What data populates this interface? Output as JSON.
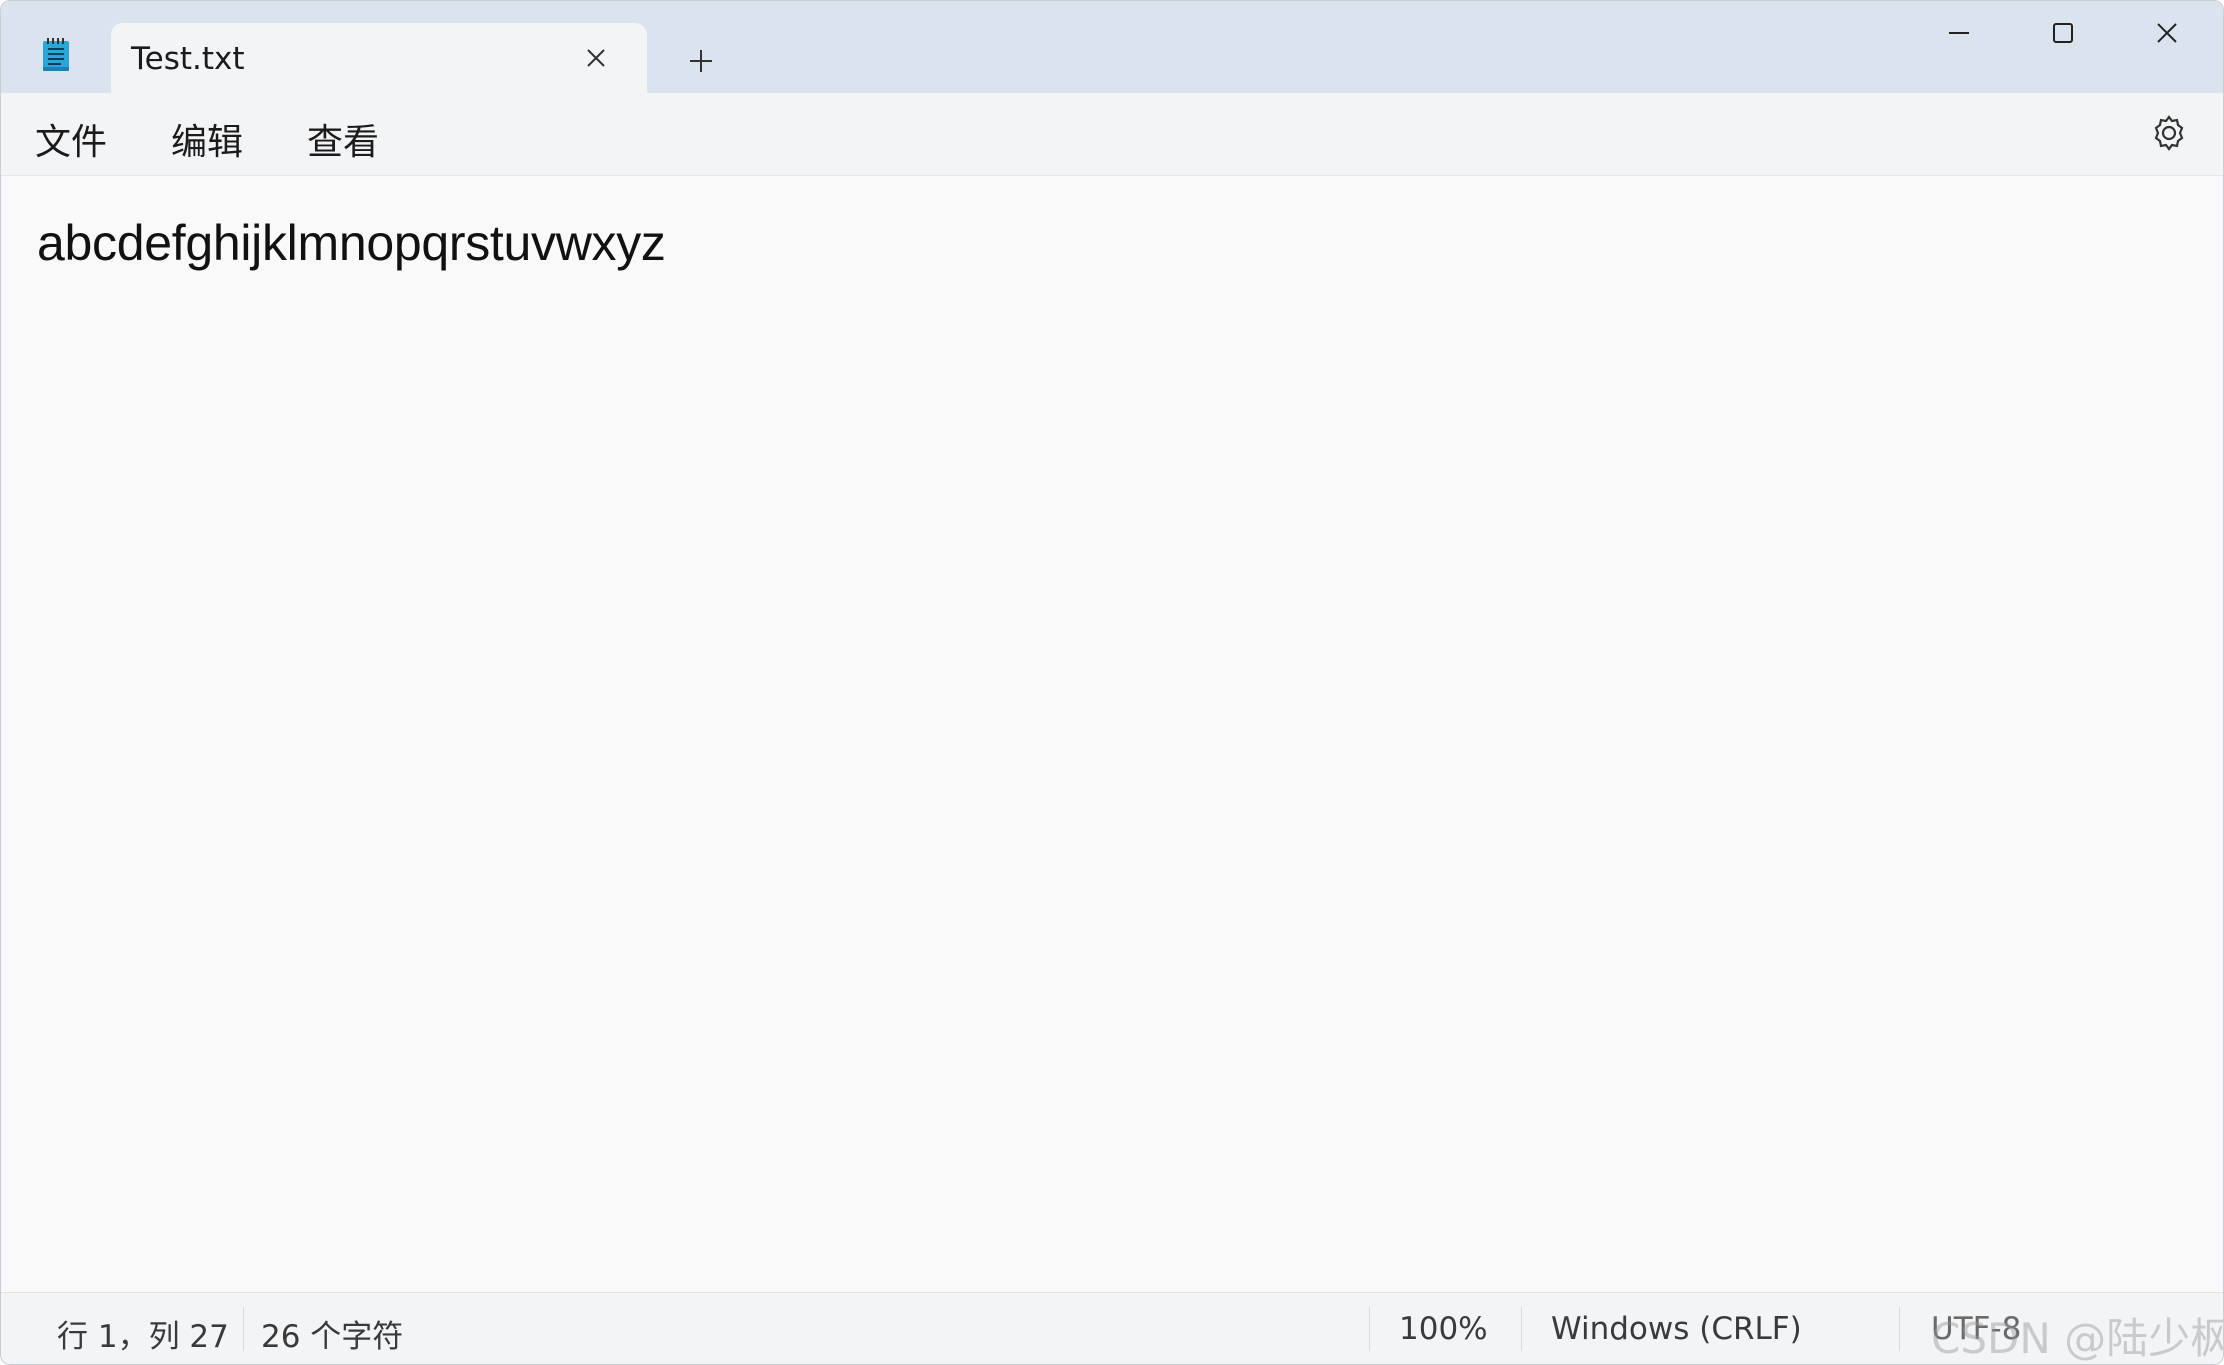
{
  "tab": {
    "title": "Test.txt"
  },
  "menu": {
    "file": "文件",
    "edit": "编辑",
    "view": "查看"
  },
  "editor": {
    "content": "abcdefghijklmnopqrstuvwxyz"
  },
  "status": {
    "position": "行 1，列 27",
    "chars": "26 个字符",
    "zoom": "100%",
    "line_ending": "Windows (CRLF)",
    "encoding": "UTF-8"
  },
  "watermark": "CSDN @陆少枫",
  "icons": {
    "app": "notepad-icon",
    "tab_close": "close-icon",
    "new_tab": "plus-icon",
    "minimize": "minimize-icon",
    "maximize": "maximize-icon",
    "close": "close-icon",
    "settings": "gear-icon"
  },
  "colors": {
    "titlebar": "#dbe3ee",
    "tab": "#f3f4f6",
    "editor": "#f9f9f9",
    "app_icon": "#2aa6d8"
  }
}
